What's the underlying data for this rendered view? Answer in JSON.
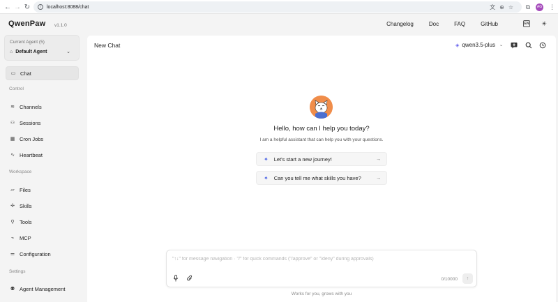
{
  "browser": {
    "url": "localhost:8088/chat",
    "profile_initials": "AG"
  },
  "header": {
    "logo": "QwenPaw",
    "version": "v1.1.0",
    "nav": [
      "Changelog",
      "Doc",
      "FAQ",
      "GitHub"
    ],
    "lang_icon_text": "EN"
  },
  "sidebar": {
    "agent_label": "Current Agent (5)",
    "agent_name": "Default Agent",
    "chat": "Chat",
    "sections": {
      "control": "Control",
      "workspace": "Workspace",
      "settings": "Settings"
    },
    "control_items": [
      "Channels",
      "Sessions",
      "Cron Jobs",
      "Heartbeat"
    ],
    "workspace_items": [
      "Files",
      "Skills",
      "Tools",
      "MCP",
      "Configuration"
    ],
    "settings_items": [
      "Agent Management"
    ]
  },
  "main": {
    "title": "New Chat",
    "model": "qwen3.5-plus",
    "welcome_title": "Hello, how can I help you today?",
    "welcome_sub": "I am a helpful assistant that can help you with your questions.",
    "prompts": [
      "Let's start a new journey!",
      "Can you tell me what skills you have?"
    ],
    "composer_placeholder": "\"↑↓\" for message navigation · \"/\" for quick commands (\"/approve\" or \"/deny\" during approvals)",
    "counter": "0/10000",
    "footer": "Works for you, grows with you"
  },
  "colors": {
    "accent": "#615ced",
    "spark": "#4f67e6",
    "avatar_bg": "#f08d4a",
    "profile_bg": "#a54bbb"
  }
}
